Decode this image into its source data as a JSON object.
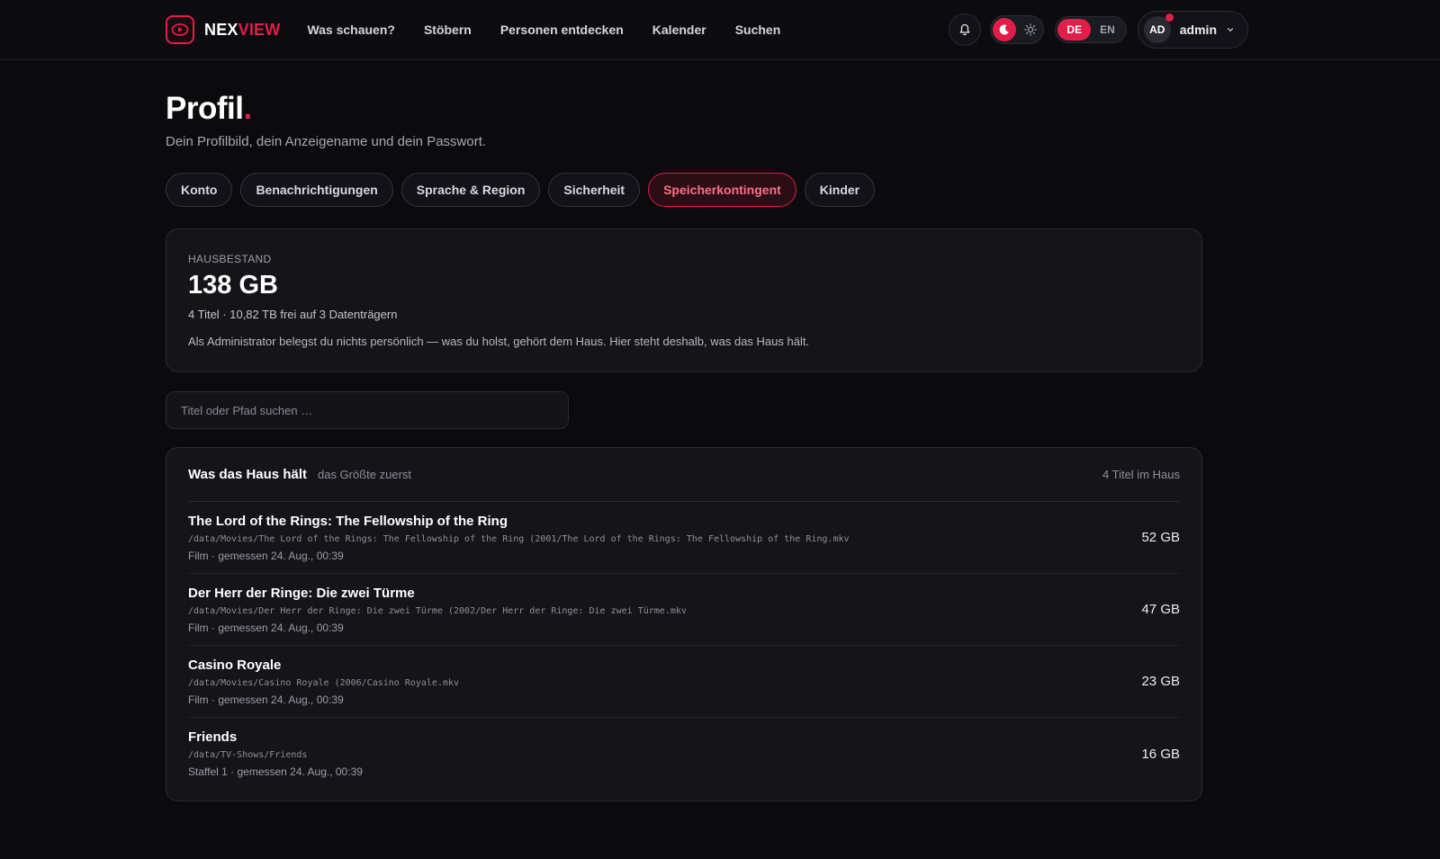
{
  "header": {
    "brand_a": "NEX",
    "brand_b": "VIEW",
    "nav": [
      "Was schauen?",
      "Stöbern",
      "Personen entdecken",
      "Kalender",
      "Suchen"
    ],
    "lang_de": "DE",
    "lang_en": "EN",
    "avatar_initials": "AD",
    "user_name": "admin"
  },
  "page": {
    "title": "Profil",
    "title_dot": ".",
    "subtitle": "Dein Profilbild, dein Anzeigename und dein Passwort."
  },
  "tabs": [
    "Konto",
    "Benachrichtigungen",
    "Sprache & Region",
    "Sicherheit",
    "Speicherkontingent",
    "Kinder"
  ],
  "active_tab": "Speicherkontingent",
  "summary": {
    "label": "HAUSBESTAND",
    "value": "138 GB",
    "meta": "4 Titel  · 10,82 TB frei auf 3 Datenträgern",
    "note": "Als Administrator belegst du nichts persönlich — was du holst, gehört dem Haus. Hier steht deshalb, was das Haus hält."
  },
  "search": {
    "placeholder": "Titel oder Pfad suchen …"
  },
  "list": {
    "title": "Was das Haus hält",
    "subtitle": "das Größte zuerst",
    "count": "4 Titel im Haus",
    "items": [
      {
        "title": "The Lord of the Rings: The Fellowship of the Ring",
        "path": "/data/Movies/The Lord of the Rings: The Fellowship of the Ring (2001/The Lord of the Rings: The Fellowship of the Ring.mkv",
        "meta": "Film  · gemessen 24. Aug., 00:39",
        "size": "52 GB"
      },
      {
        "title": "Der Herr der Ringe: Die zwei Türme",
        "path": "/data/Movies/Der Herr der Ringe: Die zwei Türme (2002/Der Herr der Ringe: Die zwei Türme.mkv",
        "meta": "Film  · gemessen 24. Aug., 00:39",
        "size": "47 GB"
      },
      {
        "title": "Casino Royale",
        "path": "/data/Movies/Casino Royale (2006/Casino Royale.mkv",
        "meta": "Film  · gemessen 24. Aug., 00:39",
        "size": "23 GB"
      },
      {
        "title": "Friends",
        "path": "/data/TV-Shows/Friends",
        "meta": "Staffel 1  · gemessen 24. Aug., 00:39",
        "size": "16 GB"
      }
    ]
  },
  "colors": {
    "accent": "#e11d48",
    "background": "#0b0b0e",
    "card": "#141419"
  },
  "icons": [
    "play-logo-icon",
    "bell-icon",
    "moon-icon",
    "sun-icon",
    "chevron-down-icon"
  ]
}
